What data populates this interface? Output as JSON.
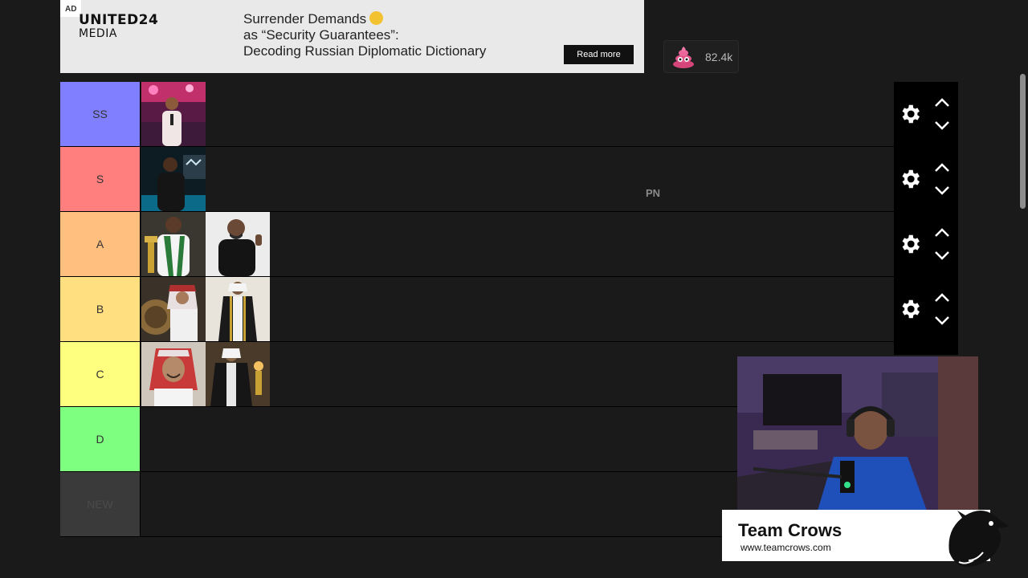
{
  "ad": {
    "tag": "AD",
    "logo_line1": "UNITED24",
    "logo_line2": "MEDIA",
    "headline_line1": "Surrender Demands",
    "headline_line2": "as “Security Guarantees”:",
    "headline_line3": "Decoding Russian Diplomatic Dictionary",
    "button": "Read more"
  },
  "reaction": {
    "icon": "poop-emoji-icon",
    "count": "82.4k"
  },
  "tiers": [
    {
      "label": "SS",
      "color": "#7f7fff",
      "items": [
        "person-pink-lights",
        null
      ]
    },
    {
      "label": "S",
      "color": "#ff7f7f",
      "items": [
        "person-dark-stage"
      ]
    },
    {
      "label": "A",
      "color": "#ffbf7f",
      "items": [
        "person-trophy",
        "person-black-shirt"
      ]
    },
    {
      "label": "B",
      "color": "#ffdf7f",
      "items": [
        "person-red-shemagh-gold",
        "person-black-bisht"
      ]
    },
    {
      "label": "C",
      "color": "#ffff7f",
      "items": [
        "person-red-shemagh-smile",
        "person-black-bisht-room"
      ]
    },
    {
      "label": "D",
      "color": "#7fff7f",
      "items": []
    },
    {
      "label": "NEW",
      "color": "#3a3a3a",
      "items": []
    }
  ],
  "overlay_text": "PN",
  "brand": {
    "name": "Team Crows",
    "url": "www.teamcrows.com"
  }
}
